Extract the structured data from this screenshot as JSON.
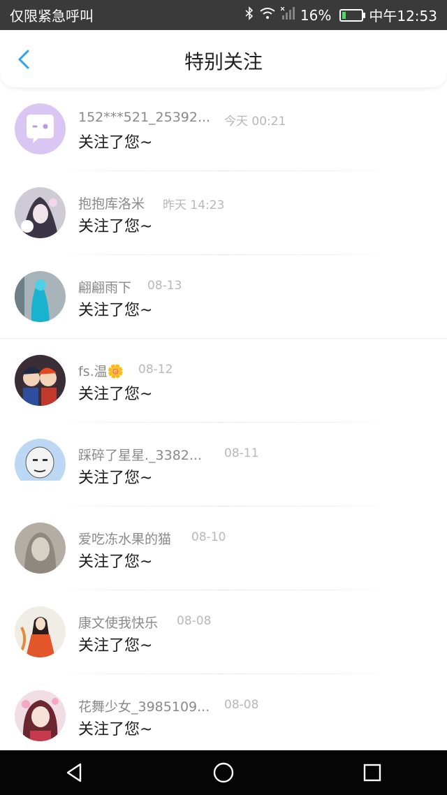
{
  "status_bar": {
    "left_text": "仅限紧急呼叫",
    "battery": "16%",
    "time": "中午12:53"
  },
  "header": {
    "title": "特别关注",
    "back_icon": "chevron-left-icon",
    "accent": "#2aa1f2"
  },
  "items": [
    {
      "name": "152***521_25392...",
      "time": "今天 00:21",
      "message": "关注了您~"
    },
    {
      "name": "抱抱库洛米",
      "time": "昨天 14:23",
      "message": "关注了您~"
    },
    {
      "name": "翩翩雨下",
      "time": "08-13",
      "message": "关注了您~"
    },
    {
      "name": "fs.温",
      "time": "08-12",
      "message": "关注了您~"
    },
    {
      "name": "踩碎了星星._3382...",
      "time": "08-11",
      "message": "关注了您~"
    },
    {
      "name": "爱吃冻水果的猫",
      "time": "08-10",
      "message": "关注了您~"
    },
    {
      "name": "康文使我快乐",
      "time": "08-08",
      "message": "关注了您~"
    },
    {
      "name": "花舞少女_3985109...",
      "time": "08-08",
      "message": "关注了您~"
    }
  ],
  "nav": {
    "back_icon": "triangle-back-icon",
    "home_icon": "circle-home-icon",
    "recents_icon": "square-recents-icon"
  }
}
